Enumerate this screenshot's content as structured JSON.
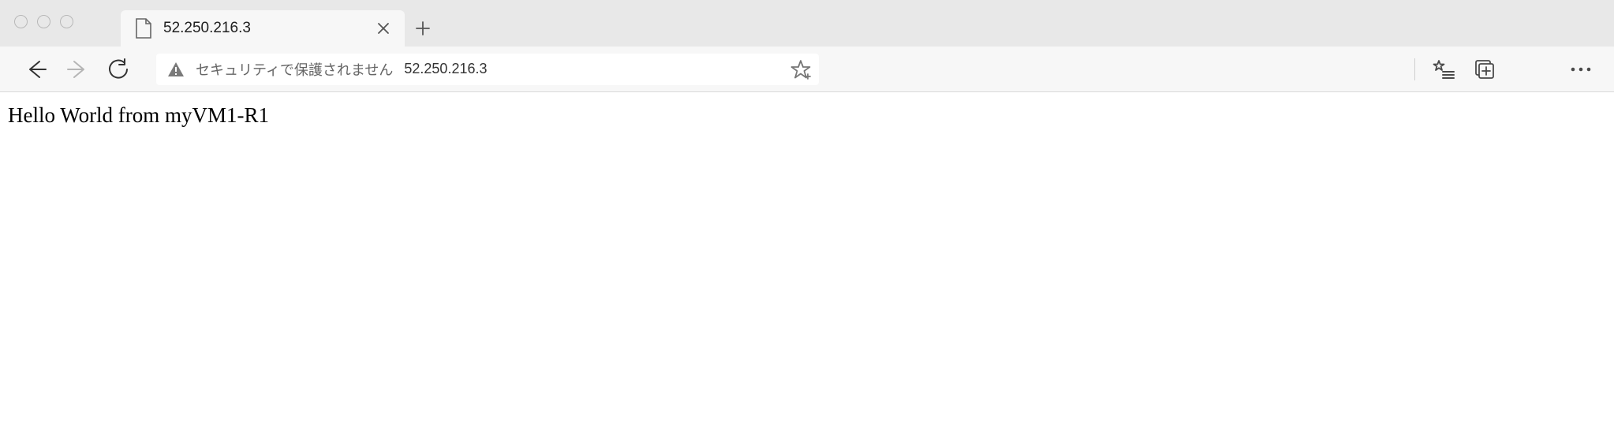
{
  "tab": {
    "title": "52.250.216.3"
  },
  "address_bar": {
    "security_label": "セキュリティで保護されません",
    "url": "52.250.216.3"
  },
  "page": {
    "body_text": "Hello World from myVM1-R1"
  }
}
